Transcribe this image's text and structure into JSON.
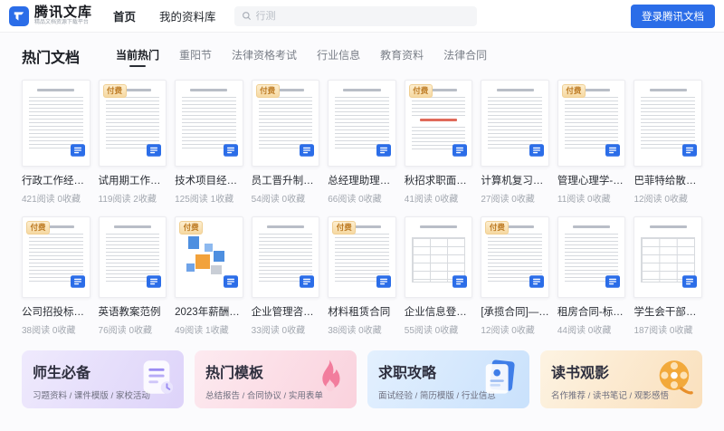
{
  "brand": {
    "name": "腾讯文库",
    "tagline": "精品文档资源下载平台",
    "login_button": "登录腾讯文档",
    "logo_icon": "tencent-wenku-logo-icon"
  },
  "nav": {
    "items": [
      {
        "label": "首页",
        "active": true
      },
      {
        "label": "我的资料库",
        "active": false
      }
    ]
  },
  "search": {
    "placeholder": "行测",
    "icon": "search-icon"
  },
  "section": {
    "title": "热门文档",
    "tabs": [
      {
        "label": "当前热门",
        "active": true
      },
      {
        "label": "重阳节",
        "active": false
      },
      {
        "label": "法律资格考试",
        "active": false
      },
      {
        "label": "行业信息",
        "active": false
      },
      {
        "label": "教育资料",
        "active": false
      },
      {
        "label": "法律合同",
        "active": false
      }
    ]
  },
  "badge_label": "付费",
  "documents": [
    {
      "title": "行政工作经验分...",
      "stats": "421阅读 0收藏",
      "paid": false,
      "variant": "text"
    },
    {
      "title": "试用期工作经验...",
      "stats": "119阅读 2收藏",
      "paid": true,
      "variant": "text"
    },
    {
      "title": "技术项目经理面...",
      "stats": "125阅读 1收藏",
      "paid": false,
      "variant": "text"
    },
    {
      "title": "员工晋升制度及...",
      "stats": "54阅读 0收藏",
      "paid": true,
      "variant": "text"
    },
    {
      "title": "总经理助理工作...",
      "stats": "66阅读 0收藏",
      "paid": false,
      "variant": "text"
    },
    {
      "title": "秋招求职面试技巧",
      "stats": "41阅读 0收藏",
      "paid": true,
      "variant": "text-red"
    },
    {
      "title": "计算机复习资料",
      "stats": "27阅读 0收藏",
      "paid": false,
      "variant": "text"
    },
    {
      "title": "管理心理学-复习...",
      "stats": "11阅读 0收藏",
      "paid": true,
      "variant": "text"
    },
    {
      "title": "巴菲特给散户的9...",
      "stats": "12阅读 0收藏",
      "paid": false,
      "variant": "text"
    },
    {
      "title": "公司招投标授权...",
      "stats": "38阅读 0收藏",
      "paid": true,
      "variant": "text"
    },
    {
      "title": "英语教案范例",
      "stats": "76阅读 0收藏",
      "paid": false,
      "variant": "text"
    },
    {
      "title": "2023年薪酬报告...",
      "stats": "49阅读 1收藏",
      "paid": true,
      "variant": "cubes"
    },
    {
      "title": "企业管理咨询合同",
      "stats": "33阅读 0收藏",
      "paid": false,
      "variant": "text"
    },
    {
      "title": "材料租赁合同",
      "stats": "38阅读 0收藏",
      "paid": true,
      "variant": "text"
    },
    {
      "title": "企业信息登记表",
      "stats": "55阅读 0收藏",
      "paid": false,
      "variant": "table"
    },
    {
      "title": "[承揽合同]—加...",
      "stats": "12阅读 0收藏",
      "paid": true,
      "variant": "text"
    },
    {
      "title": "租房合同-标准版",
      "stats": "44阅读 0收藏",
      "paid": false,
      "variant": "text"
    },
    {
      "title": "学生会干部竞选...",
      "stats": "187阅读 0收藏",
      "paid": false,
      "variant": "table"
    }
  ],
  "doc_file_icon": "doc-file-icon",
  "banners": [
    {
      "title": "师生必备",
      "subtitle": "习题资料 / 课件模版 / 家校活动",
      "icon": "notebook-icon",
      "theme": "purple"
    },
    {
      "title": "热门模板",
      "subtitle": "总结报告 / 合同协议 / 实用表单",
      "icon": "flame-icon",
      "theme": "pink"
    },
    {
      "title": "求职攻略",
      "subtitle": "面试经验 / 简历模版 / 行业信息",
      "icon": "resume-icon",
      "theme": "blue"
    },
    {
      "title": "读书观影",
      "subtitle": "名作推荐 / 读书笔记 / 观影感悟",
      "icon": "film-reel-icon",
      "theme": "orange"
    }
  ],
  "colors": {
    "accent": "#2b6de8",
    "paid_badge_text": "#bd7a22",
    "paid_badge_bg": "#f6d9a2",
    "active_tab_underline": "#2a2e36"
  }
}
